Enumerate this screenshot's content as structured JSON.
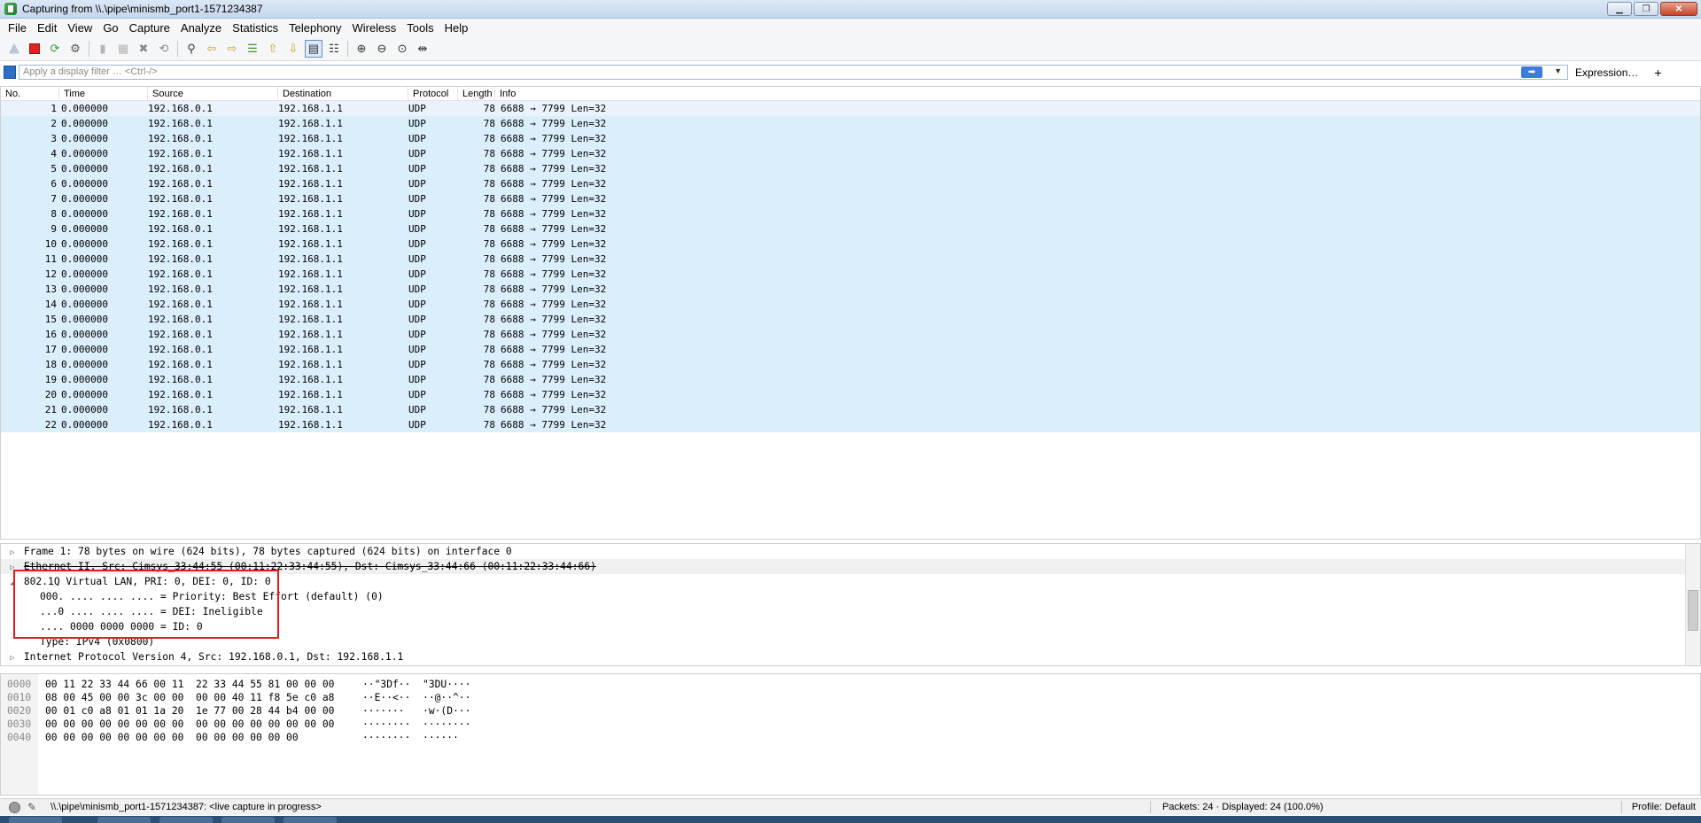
{
  "window": {
    "title": "Capturing from \\\\.\\pipe\\minismb_port1-1571234387"
  },
  "menu": [
    "File",
    "Edit",
    "View",
    "Go",
    "Capture",
    "Analyze",
    "Statistics",
    "Telephony",
    "Wireless",
    "Tools",
    "Help"
  ],
  "toolbar": {
    "icons": [
      "start-capture-icon",
      "stop-capture-icon",
      "restart-capture-icon",
      "capture-options-icon",
      "open-file-icon",
      "save-file-icon",
      "close-file-icon",
      "reload-file-icon",
      "find-packet-icon",
      "go-back-icon",
      "go-forward-icon",
      "go-to-packet-icon",
      "go-first-icon",
      "go-last-icon",
      "autoscroll-icon",
      "colorize-icon",
      "zoom-in-icon",
      "zoom-out-icon",
      "normal-size-icon",
      "resize-columns-icon"
    ]
  },
  "filter": {
    "placeholder": "Apply a display filter … <Ctrl-/>",
    "expression_label": "Expression…",
    "add_label": "+",
    "apply_icon": "apply-arrow-icon"
  },
  "packet_list": {
    "columns": [
      "No.",
      "Time",
      "Source",
      "Destination",
      "Protocol",
      "Length",
      "Info"
    ],
    "rows": [
      [
        "1",
        "0.000000",
        "192.168.0.1",
        "192.168.1.1",
        "UDP",
        "78",
        "6688 → 7799 Len=32"
      ],
      [
        "2",
        "0.000000",
        "192.168.0.1",
        "192.168.1.1",
        "UDP",
        "78",
        "6688 → 7799 Len=32"
      ],
      [
        "3",
        "0.000000",
        "192.168.0.1",
        "192.168.1.1",
        "UDP",
        "78",
        "6688 → 7799 Len=32"
      ],
      [
        "4",
        "0.000000",
        "192.168.0.1",
        "192.168.1.1",
        "UDP",
        "78",
        "6688 → 7799 Len=32"
      ],
      [
        "5",
        "0.000000",
        "192.168.0.1",
        "192.168.1.1",
        "UDP",
        "78",
        "6688 → 7799 Len=32"
      ],
      [
        "6",
        "0.000000",
        "192.168.0.1",
        "192.168.1.1",
        "UDP",
        "78",
        "6688 → 7799 Len=32"
      ],
      [
        "7",
        "0.000000",
        "192.168.0.1",
        "192.168.1.1",
        "UDP",
        "78",
        "6688 → 7799 Len=32"
      ],
      [
        "8",
        "0.000000",
        "192.168.0.1",
        "192.168.1.1",
        "UDP",
        "78",
        "6688 → 7799 Len=32"
      ],
      [
        "9",
        "0.000000",
        "192.168.0.1",
        "192.168.1.1",
        "UDP",
        "78",
        "6688 → 7799 Len=32"
      ],
      [
        "10",
        "0.000000",
        "192.168.0.1",
        "192.168.1.1",
        "UDP",
        "78",
        "6688 → 7799 Len=32"
      ],
      [
        "11",
        "0.000000",
        "192.168.0.1",
        "192.168.1.1",
        "UDP",
        "78",
        "6688 → 7799 Len=32"
      ],
      [
        "12",
        "0.000000",
        "192.168.0.1",
        "192.168.1.1",
        "UDP",
        "78",
        "6688 → 7799 Len=32"
      ],
      [
        "13",
        "0.000000",
        "192.168.0.1",
        "192.168.1.1",
        "UDP",
        "78",
        "6688 → 7799 Len=32"
      ],
      [
        "14",
        "0.000000",
        "192.168.0.1",
        "192.168.1.1",
        "UDP",
        "78",
        "6688 → 7799 Len=32"
      ],
      [
        "15",
        "0.000000",
        "192.168.0.1",
        "192.168.1.1",
        "UDP",
        "78",
        "6688 → 7799 Len=32"
      ],
      [
        "16",
        "0.000000",
        "192.168.0.1",
        "192.168.1.1",
        "UDP",
        "78",
        "6688 → 7799 Len=32"
      ],
      [
        "17",
        "0.000000",
        "192.168.0.1",
        "192.168.1.1",
        "UDP",
        "78",
        "6688 → 7799 Len=32"
      ],
      [
        "18",
        "0.000000",
        "192.168.0.1",
        "192.168.1.1",
        "UDP",
        "78",
        "6688 → 7799 Len=32"
      ],
      [
        "19",
        "0.000000",
        "192.168.0.1",
        "192.168.1.1",
        "UDP",
        "78",
        "6688 → 7799 Len=32"
      ],
      [
        "20",
        "0.000000",
        "192.168.0.1",
        "192.168.1.1",
        "UDP",
        "78",
        "6688 → 7799 Len=32"
      ],
      [
        "21",
        "0.000000",
        "192.168.0.1",
        "192.168.1.1",
        "UDP",
        "78",
        "6688 → 7799 Len=32"
      ],
      [
        "22",
        "0.000000",
        "192.168.0.1",
        "192.168.1.1",
        "UDP",
        "78",
        "6688 → 7799 Len=32"
      ]
    ]
  },
  "details": {
    "frame": "Frame 1: 78 bytes on wire (624 bits), 78 bytes captured (624 bits) on interface 0",
    "ethernet": "Ethernet II, Src: Cimsys_33:44:55 (00:11:22:33:44:55), Dst: Cimsys_33:44:66 (00:11:22:33:44:66)",
    "vlan": "802.1Q Virtual LAN, PRI: 0, DEI: 0, ID: 0",
    "vlan_priority": "000. .... .... .... = Priority: Best Effort (default) (0)",
    "vlan_dei": "...0 .... .... .... = DEI: Ineligible",
    "vlan_id": ".... 0000 0000 0000 = ID: 0",
    "vlan_type": "Type: IPv4 (0x0800)",
    "ipv4": "Internet Protocol Version 4, Src: 192.168.0.1, Dst: 192.168.1.1"
  },
  "bytes": [
    {
      "offset": "0000",
      "hex": "00 11 22 33 44 66 00 11  22 33 44 55 81 00 00 00",
      "ascii": "··\"3Df··  \"3DU····"
    },
    {
      "offset": "0010",
      "hex": "08 00 45 00 00 3c 00 00  00 00 40 11 f8 5e c0 a8",
      "ascii": "··E··<··  ··@··^··"
    },
    {
      "offset": "0020",
      "hex": "00 01 c0 a8 01 01 1a 20  1e 77 00 28 44 b4 00 00",
      "ascii": "·······   ·w·(D···"
    },
    {
      "offset": "0030",
      "hex": "00 00 00 00 00 00 00 00  00 00 00 00 00 00 00 00",
      "ascii": "········  ········"
    },
    {
      "offset": "0040",
      "hex": "00 00 00 00 00 00 00 00  00 00 00 00 00 00",
      "ascii": "········  ······"
    }
  ],
  "status": {
    "capture_text": "\\\\.\\pipe\\minismb_port1-1571234387: <live capture in progress>",
    "packets": "Packets: 24 · Displayed: 24 (100.0%)",
    "profile": "Profile: Default"
  }
}
